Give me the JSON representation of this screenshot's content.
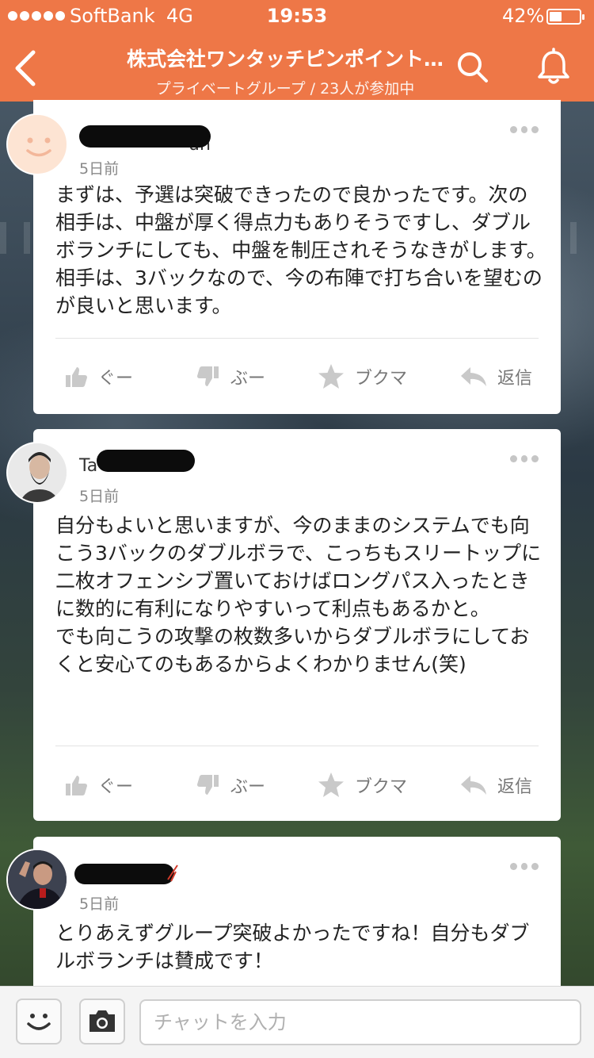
{
  "status_bar": {
    "carrier": "SoftBank",
    "network": "4G",
    "time": "19:53",
    "battery_percent": "42%",
    "battery_level": 0.42
  },
  "header": {
    "title": "株式会社ワンタッチピンポイント…",
    "subtitle": "プライベートグループ / 23人が参加中",
    "background_color": "#ee7747"
  },
  "posts": [
    {
      "name_visible_fragment": "un",
      "time": "5日前",
      "text": "まずは、予選は突破できったので良かったです。次の相手は、中盤が厚く得点力もありそうですし、ダブルボランチにしても、中盤を制圧されそうなきがします。相手は、3バックなので、今の布陣で打ち合いを望むのが良いと思います。",
      "actions": {
        "good": "ぐー",
        "bad": "ぶー",
        "bookmark": "ブクマ",
        "reply": "返信"
      }
    },
    {
      "name_visible_fragment": "Ta",
      "time": "5日前",
      "text": "自分もよいと思いますが、今のままのシステムでも向こう3バックのダブルボラで、こっちもスリートップに二枚オフェンシブ置いておけばロングパス入ったときに数的に有利になりやすいって利点もあるかと。\nでも向こうの攻撃の枚数多いからダブルボラにしておくと安心てのもあるからよくわかりません(笑)",
      "actions": {
        "good": "ぐー",
        "bad": "ぶー",
        "bookmark": "ブクマ",
        "reply": "返信"
      }
    },
    {
      "name_visible_fragment": "",
      "time": "5日前",
      "text": "とりあえずグループ突破よかったですね！自分もダブルボランチは賛成です！"
    }
  ],
  "chat": {
    "placeholder": "チャットを入力",
    "stamp_icon": "smiley-icon",
    "camera_icon": "camera-icon"
  }
}
